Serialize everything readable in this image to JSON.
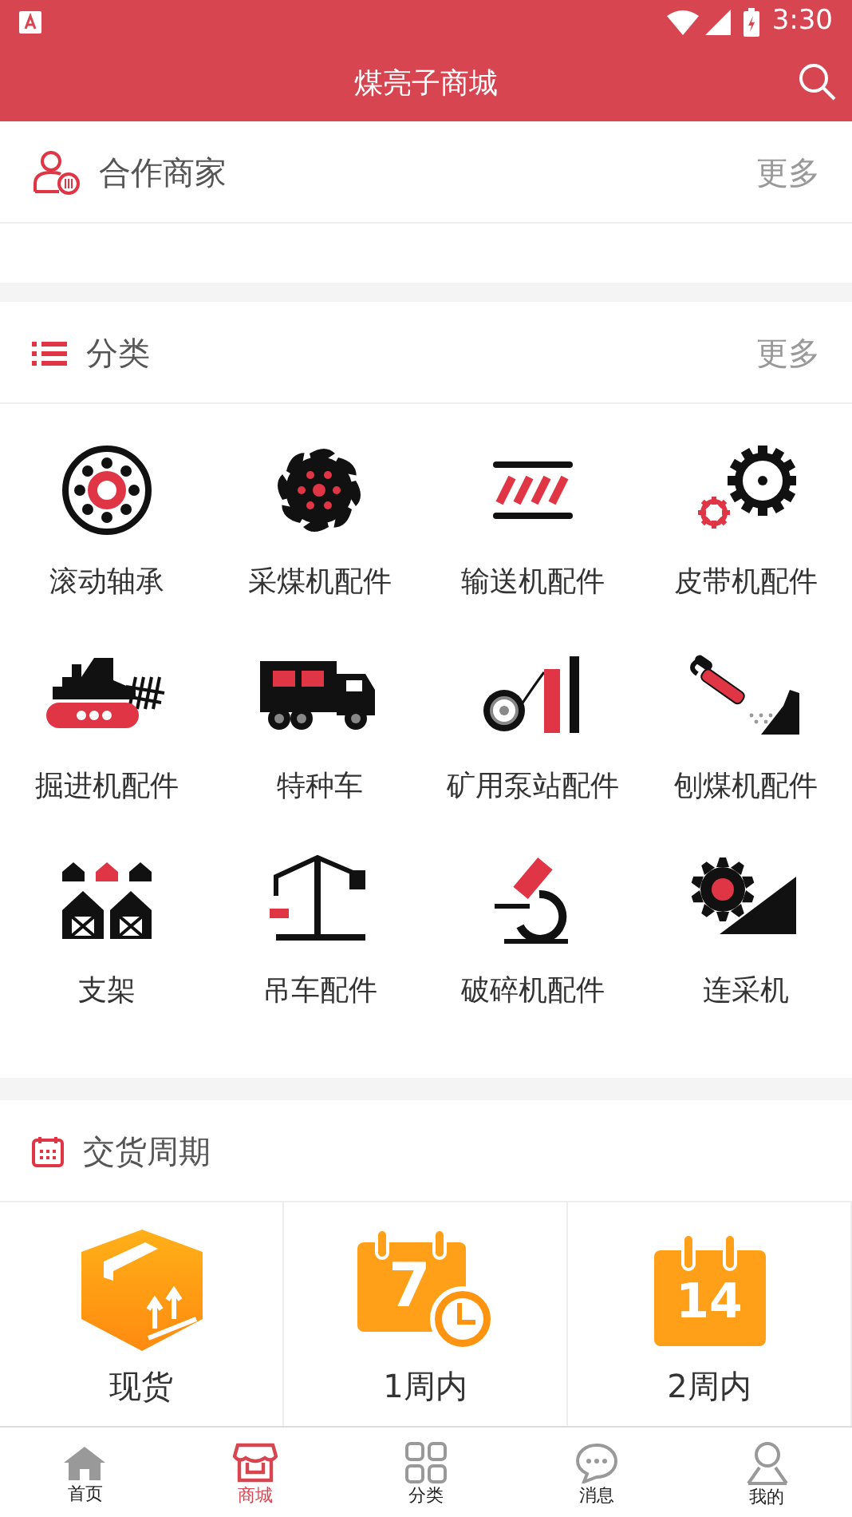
{
  "status_bar": {
    "time": "3:30"
  },
  "app_bar": {
    "title": "煤亮子商城"
  },
  "partners": {
    "title": "合作商家",
    "more": "更多"
  },
  "categories": {
    "title": "分类",
    "more": "更多",
    "items": [
      {
        "label": "滚动轴承"
      },
      {
        "label": "采煤机配件"
      },
      {
        "label": "输送机配件"
      },
      {
        "label": "皮带机配件"
      },
      {
        "label": "掘进机配件"
      },
      {
        "label": "特种车"
      },
      {
        "label": "矿用泵站配件"
      },
      {
        "label": "刨煤机配件"
      },
      {
        "label": "支架"
      },
      {
        "label": "吊车配件"
      },
      {
        "label": "破碎机配件"
      },
      {
        "label": "连采机"
      }
    ]
  },
  "delivery": {
    "title": "交货周期",
    "items": [
      {
        "label": "现货"
      },
      {
        "label": "1周内",
        "icon_number": "7"
      },
      {
        "label": "2周内",
        "icon_number": "14"
      }
    ]
  },
  "bottom_nav": [
    {
      "label": "首页",
      "selected": false
    },
    {
      "label": "商城",
      "selected": true
    },
    {
      "label": "分类",
      "selected": false
    },
    {
      "label": "消息",
      "selected": false
    },
    {
      "label": "我的",
      "selected": false
    }
  ]
}
